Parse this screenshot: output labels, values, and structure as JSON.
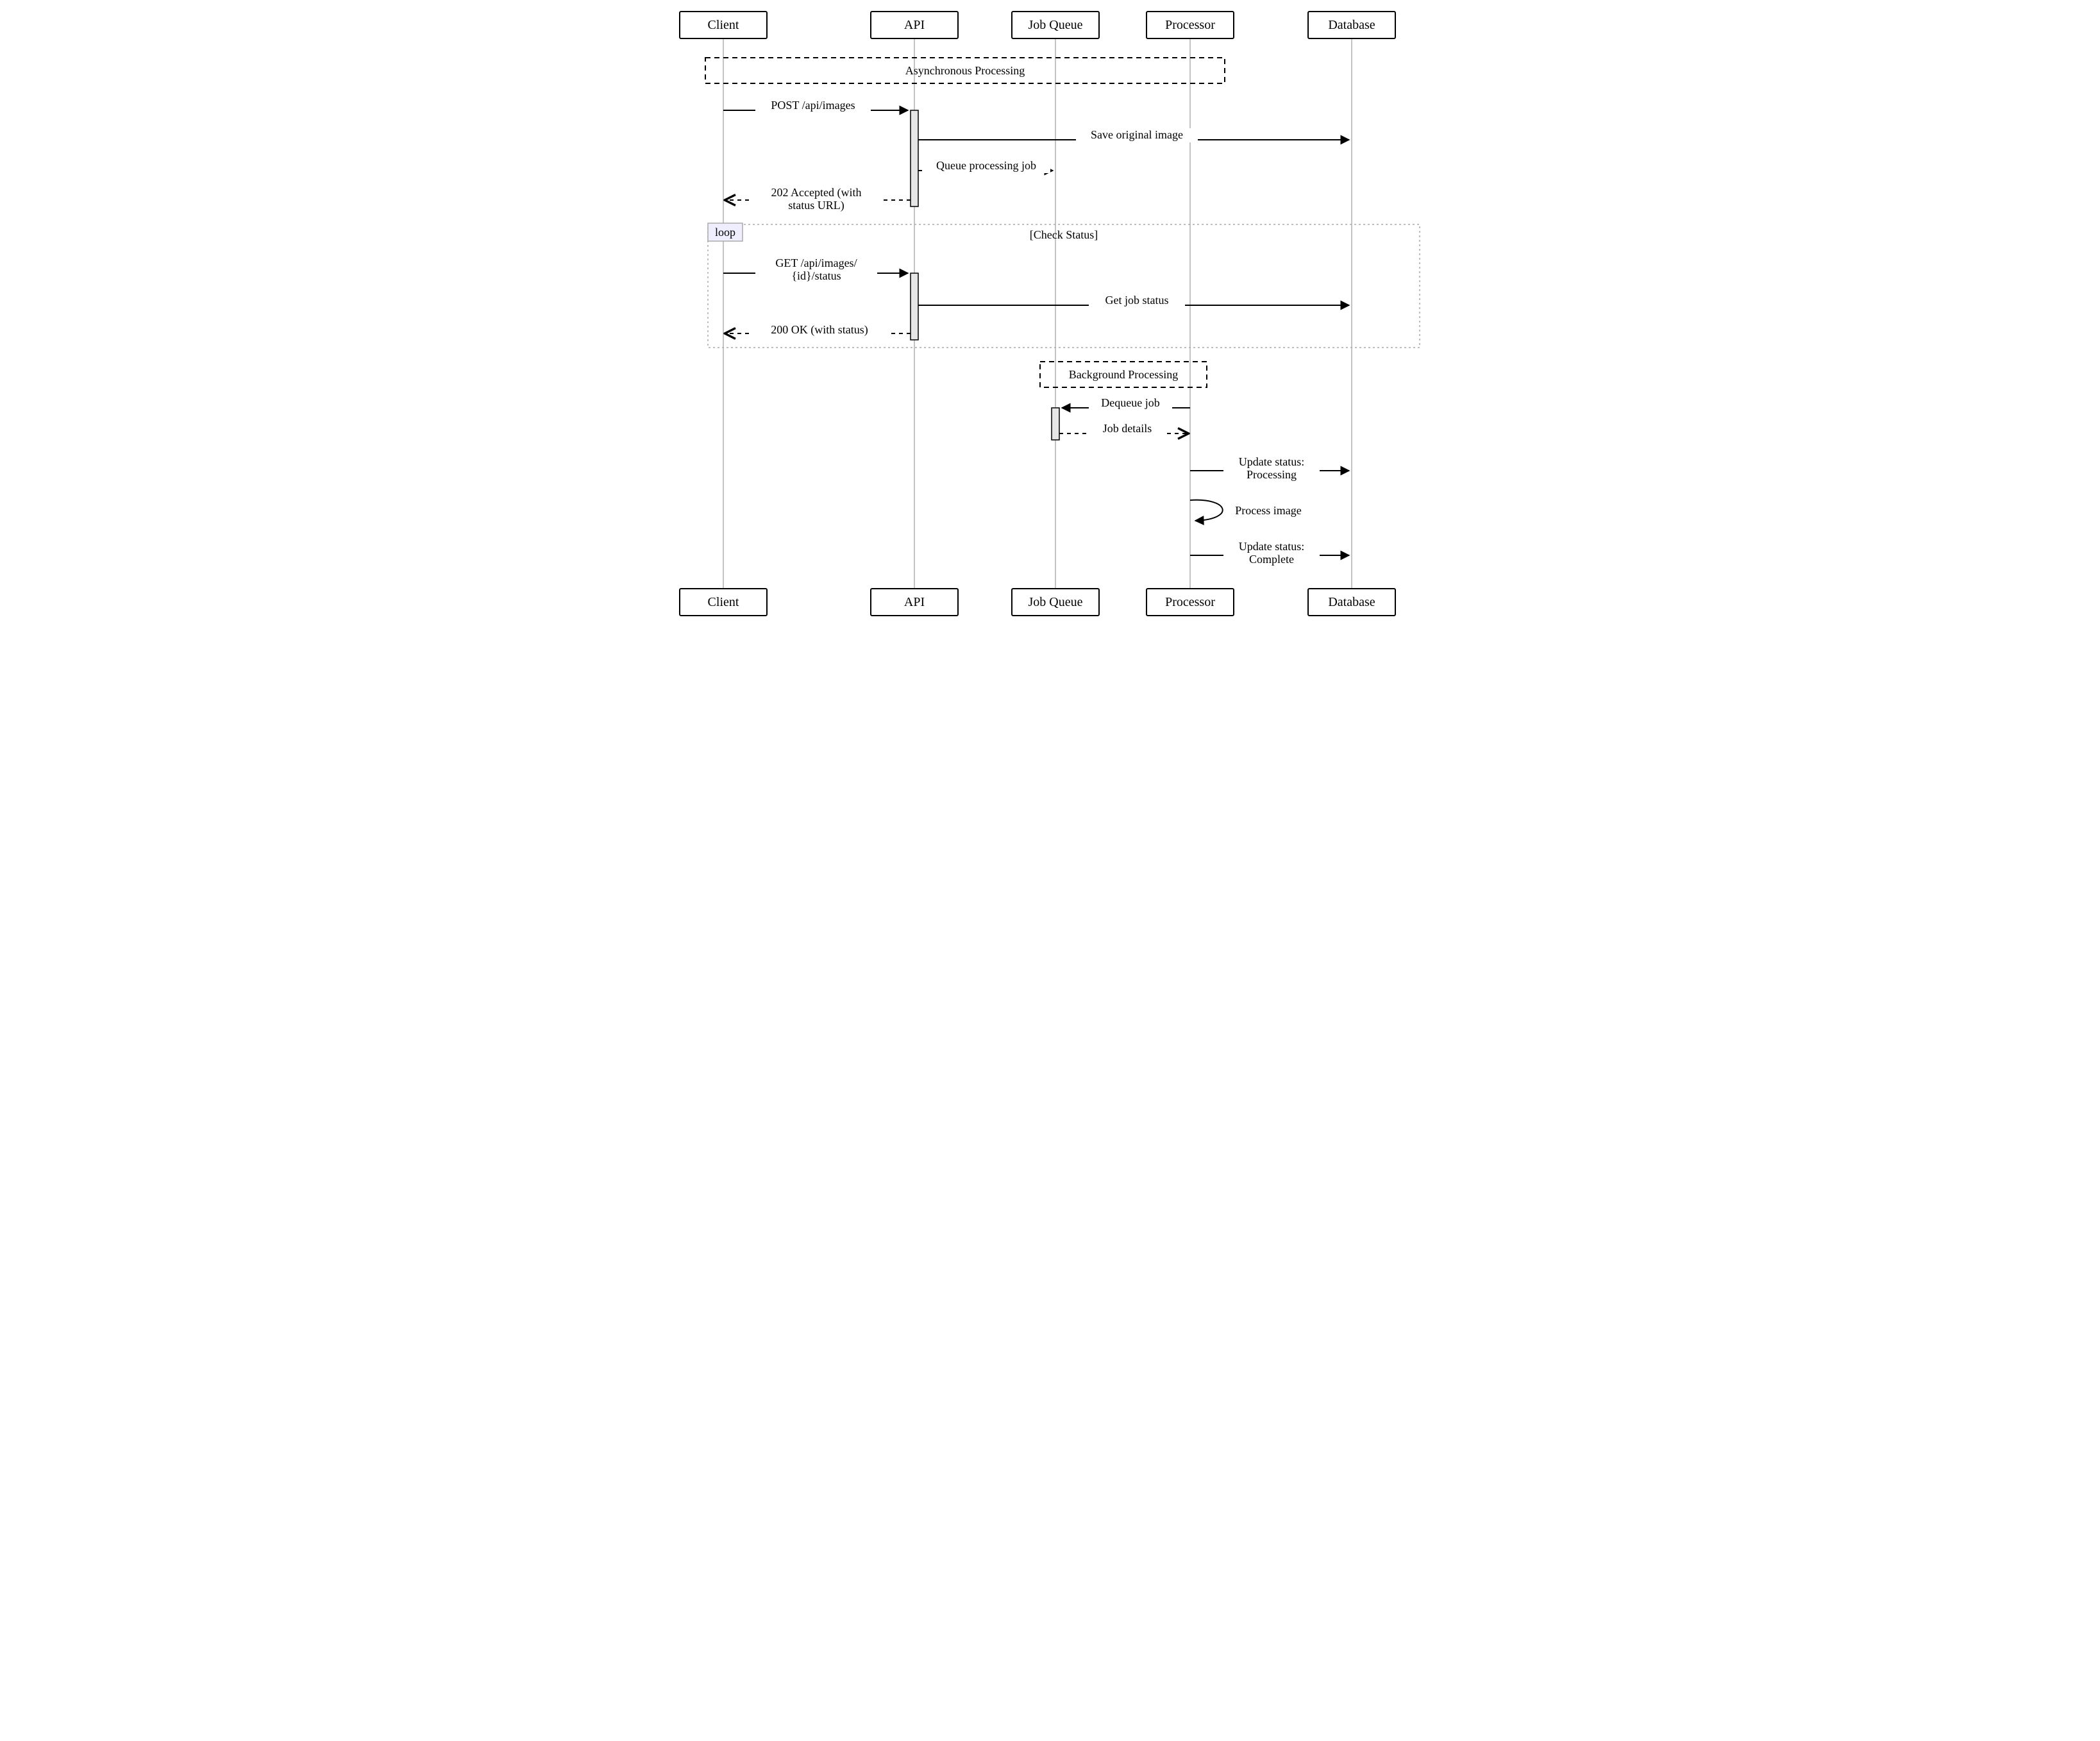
{
  "actors": {
    "client": "Client",
    "api": "API",
    "queue": "Job Queue",
    "processor": "Processor",
    "database": "Database"
  },
  "notes": {
    "async": "Asynchronous Processing",
    "background": "Background Processing"
  },
  "loop": {
    "tag": "loop",
    "title": "[Check Status]"
  },
  "messages": {
    "m1": "POST /api/images",
    "m2": "Save original image",
    "m3": "Queue processing job",
    "m4a": "202 Accepted (with",
    "m4b": "status URL)",
    "m5a": "GET /api/images/",
    "m5b": "{id}/status",
    "m6": "Get job status",
    "m7": "200 OK (with status)",
    "m8": "Dequeue job",
    "m9": "Job details",
    "m10a": "Update status:",
    "m10b": "Processing",
    "m11": "Process image",
    "m12a": "Update status:",
    "m12b": "Complete"
  }
}
